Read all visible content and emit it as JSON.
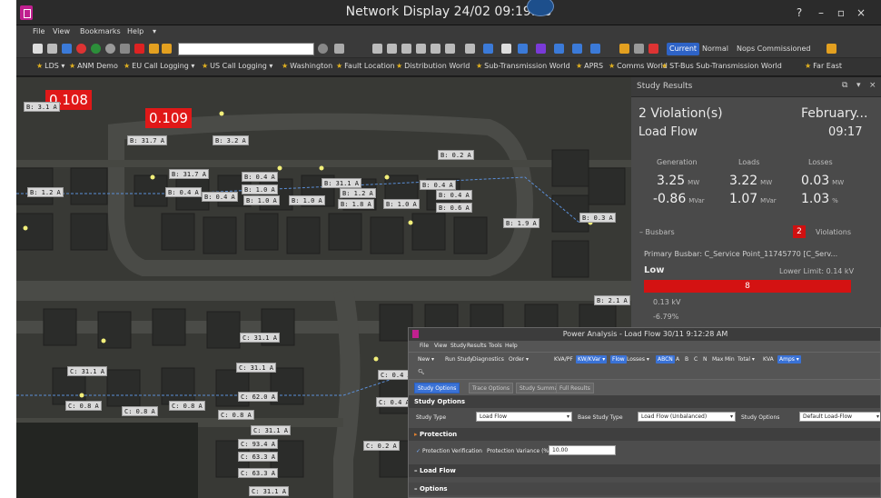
{
  "app": {
    "title": "Network Display 24/02 09:19:18",
    "help_label": "?",
    "minimize_label": "–",
    "maximize_label": "▫",
    "close_label": "×"
  },
  "menu": [
    "File",
    "View",
    "Bookmarks",
    "Help",
    "▾"
  ],
  "toolbar": {
    "search_placeholder": "",
    "current_label": "Current",
    "normal_label": "Normal",
    "nops_label": "Nops Commissioned",
    "colors": {
      "accent": "#2e63c6"
    }
  },
  "bookmarks": [
    "LDS ▾",
    "ANM Demo",
    "EU Call Logging ▾",
    "US Call Logging ▾",
    "Washington",
    "Fault Location",
    "Distribution World",
    "Sub-Transmission World",
    "APRS",
    "Comms World",
    "ST-Bus Sub-Transmission World",
    "Far East"
  ],
  "map": {
    "violations": [
      "0.108",
      "0.109"
    ],
    "labels": [
      "B: 3.1 A",
      "B: 31.7 A",
      "B: 3.2 A",
      "B: 0.2 A",
      "B: 1.2 A",
      "B: 31.7 A",
      "B: 0.4 A",
      "B: 0.4 A",
      "B: 0.4 A",
      "B: 31.1 A",
      "B: 1.0 A",
      "B: 1.0 A",
      "B: 1.2 A",
      "B: 0.4 A",
      "B: 0.4 A",
      "B: 1.0 A",
      "B: 1.8 A",
      "B: 1.0 A",
      "B: 0.6 A",
      "B: 0.3 A",
      "B: 1.9 A",
      "B: 2.1 A",
      "C: 31.1 A",
      "C: 31.1 A",
      "C: 31.1 A",
      "C: 0.4 A",
      "C: 0.8 A",
      "C: 0.8 A",
      "C: 0.8 A",
      "C: 62.0 A",
      "C: 0.4 A",
      "C: 0.8 A",
      "C: 31.1 A",
      "C: 93.4 A",
      "C: 63.3 A",
      "C: 63.3 A",
      "C: 31.1 A",
      "C: 0.2 A"
    ]
  },
  "study": {
    "header": "Study Results",
    "violations_text": "2 Violation(s)",
    "date_text": "February...",
    "mode": "Load Flow",
    "time": "09:17",
    "columns": [
      "Generation",
      "Loads",
      "Losses"
    ],
    "rows": [
      [
        {
          "v": "3.25",
          "u": "MW"
        },
        {
          "v": "3.22",
          "u": "MW"
        },
        {
          "v": "0.03",
          "u": "MW"
        }
      ],
      [
        {
          "v": "-0.86",
          "u": "MVar"
        },
        {
          "v": "1.07",
          "u": "MVar"
        },
        {
          "v": "1.03",
          "u": "%"
        }
      ]
    ],
    "busbars_label": "Busbars",
    "violation_count": "2",
    "violations_label": "Violations",
    "primary_busbar": "Primary Busbar: C_Service Point_11745770 [C_Serv...",
    "low_label": "Low",
    "lower_limit": "Lower Limit: 0.14 kV",
    "low_bar_value": "8",
    "kv_value": "0.13 kV",
    "pct_value": "-6.79%"
  },
  "power_dialog": {
    "title": "Power Analysis - Load Flow 30/11 9:12:28 AM",
    "menu": [
      "File",
      "View",
      "Study",
      "Results",
      "Tools",
      "Help"
    ],
    "toolbar": [
      "New ▾",
      "Run Study",
      "Diagnostics",
      "Order ▾",
      "KVA/PF",
      "KW/KVar ▾",
      "Flow",
      "Losses ▾",
      "ABCN",
      "A",
      "B",
      "C",
      "N",
      "Max",
      "Min",
      "Total ▾",
      "KVA",
      "Amps ▾"
    ],
    "tabs": [
      "Study Options",
      "Trace Options",
      "Study Summary",
      "Full Results"
    ],
    "section_study_options": "Study Options",
    "study_type_label": "Study Type",
    "study_type_value": "Load Flow",
    "base_study_type_label": "Base Study Type",
    "base_study_type_value": "Load Flow (Unbalanced)",
    "study_options_label": "Study Options",
    "study_options_value": "Default Load-Flow",
    "section_protection": "Protection",
    "protection_verification_label": "Protection Verification",
    "protection_variance_label": "Protection Variance (%)",
    "protection_variance_value": "10.00",
    "section_load_flow": "Load Flow",
    "section_options": "Options"
  }
}
